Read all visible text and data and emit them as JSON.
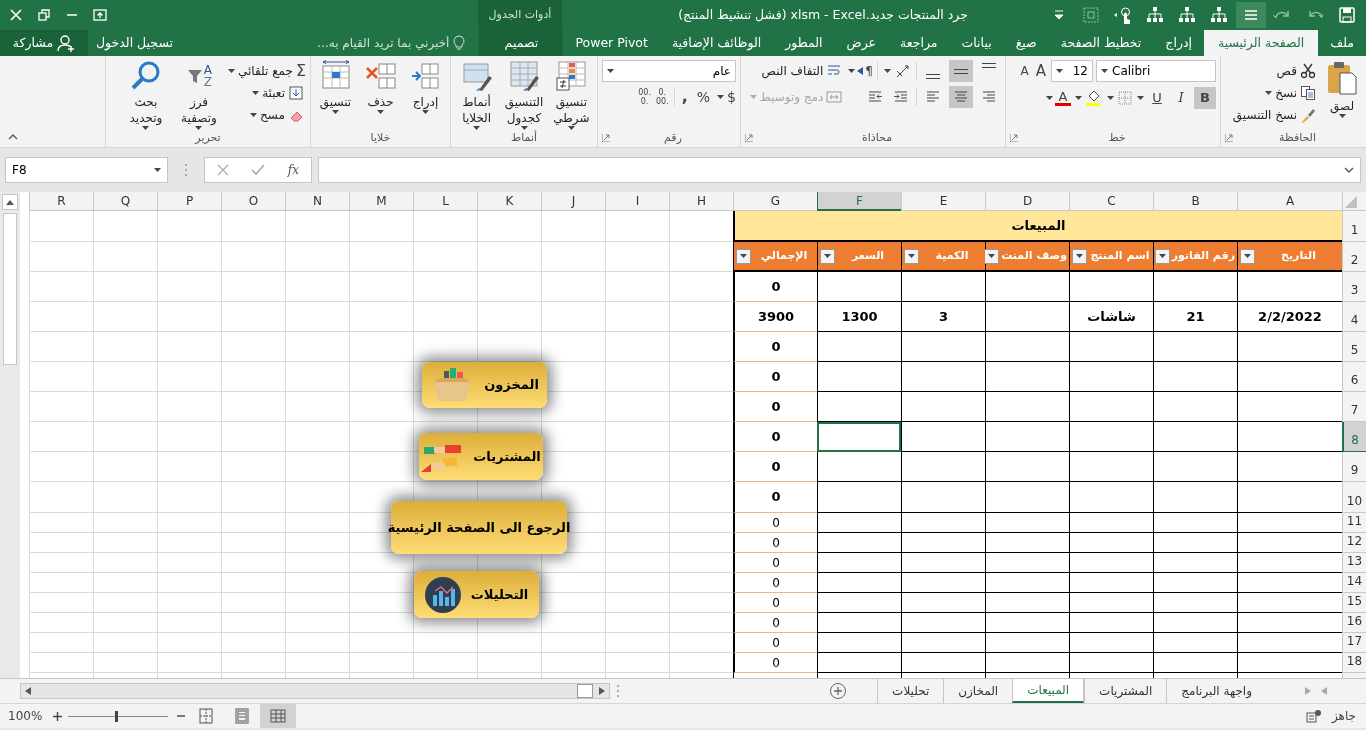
{
  "title_bar": {
    "title": "جرد المنتجات جديد.xlsm - Excel (فشل تنشيط المنتج)",
    "context_label": "أدوات الجدول"
  },
  "tabs": [
    {
      "label": "ملف",
      "selected": false,
      "kind": "tab"
    },
    {
      "label": "الصفحة الرئيسية",
      "selected": true,
      "kind": "tab"
    },
    {
      "label": "إدراج",
      "selected": false,
      "kind": "tab"
    },
    {
      "label": "تخطيط الصفحة",
      "selected": false,
      "kind": "tab"
    },
    {
      "label": "صيغ",
      "selected": false,
      "kind": "tab"
    },
    {
      "label": "بيانات",
      "selected": false,
      "kind": "tab"
    },
    {
      "label": "مراجعة",
      "selected": false,
      "kind": "tab"
    },
    {
      "label": "عرض",
      "selected": false,
      "kind": "tab"
    },
    {
      "label": "المطور",
      "selected": false,
      "kind": "tab"
    },
    {
      "label": "الوظائف الإضافية",
      "selected": false,
      "kind": "tab"
    },
    {
      "label": "Power Pivot",
      "selected": false,
      "kind": "tab"
    },
    {
      "label": "تصميم",
      "selected": false,
      "kind": "context"
    }
  ],
  "tell_me": {
    "placeholder": "أخبرني بما تريد القيام به..."
  },
  "sign_in": "تسجيل الدخول",
  "share": "مشاركة",
  "ribbon": {
    "clipboard": {
      "label": "الحافظة",
      "paste": "لصق",
      "cut": "قص",
      "copy": "نسخ",
      "format_painter": "نسخ التنسيق"
    },
    "font": {
      "label": "خط",
      "font_name": "Calibri",
      "font_size": "12",
      "grow": "A",
      "shrink": "A",
      "bold": {
        "label": "B",
        "on": true
      },
      "italic": "I",
      "underline": "U",
      "font_color": "A"
    },
    "alignment": {
      "label": "محاذاة",
      "vertical": [
        {
          "selected": false
        },
        {
          "selected": true
        },
        {
          "selected": false
        }
      ],
      "horizontal": [
        {
          "selected": false
        },
        {
          "selected": true
        },
        {
          "selected": false
        }
      ],
      "direction": "¶",
      "wrap_text": "التفاف النص",
      "merge": {
        "label": "دمج وتوسيط",
        "disabled": true
      }
    },
    "number": {
      "label": "رقم",
      "format": "عام",
      "currency": "$",
      "percent": "%",
      "comma": ",",
      "decimals": [
        ".0",
        ".00",
        ".00",
        ".0"
      ]
    },
    "styles": {
      "label": "أنماط",
      "buttons": [
        "تنسيق شرطي",
        "التنسيق كجدول",
        "أنماط الخلايا"
      ]
    },
    "cells": {
      "label": "خلايا",
      "buttons": [
        "إدراج",
        "حذف",
        "تنسيق"
      ]
    },
    "editing": {
      "label": "تحرير",
      "autosum_icon": "Σ",
      "autosum": "جمع تلقائي",
      "fill": "تعبئة",
      "clear": "مسح",
      "sort_letters": [
        "A",
        "Z"
      ],
      "sort": "فرز وتصفية",
      "find": "بحث وتحديد"
    }
  },
  "formula_bar": {
    "name_box": "F8",
    "fx": "fx"
  },
  "sheet": {
    "columns": [
      {
        "label": "A",
        "selected": false
      },
      {
        "label": "B",
        "selected": false
      },
      {
        "label": "C",
        "selected": false
      },
      {
        "label": "D",
        "selected": false
      },
      {
        "label": "E",
        "selected": false
      },
      {
        "label": "F",
        "selected": true
      },
      {
        "label": "G",
        "selected": false
      },
      {
        "label": "H",
        "selected": false
      },
      {
        "label": "I",
        "selected": false
      },
      {
        "label": "J",
        "selected": false
      },
      {
        "label": "K",
        "selected": false
      },
      {
        "label": "L",
        "selected": false
      },
      {
        "label": "M",
        "selected": false
      },
      {
        "label": "N",
        "selected": false
      },
      {
        "label": "O",
        "selected": false
      },
      {
        "label": "P",
        "selected": false
      },
      {
        "label": "Q",
        "selected": false
      },
      {
        "label": "R",
        "selected": false
      }
    ],
    "row_headers": [
      {
        "label": "1",
        "selected": false
      },
      {
        "label": "2",
        "selected": false
      },
      {
        "label": "3",
        "selected": false
      },
      {
        "label": "4",
        "selected": false
      },
      {
        "label": "5",
        "selected": false
      },
      {
        "label": "6",
        "selected": false
      },
      {
        "label": "7",
        "selected": false
      },
      {
        "label": "8",
        "selected": true
      },
      {
        "label": "9",
        "selected": false
      },
      {
        "label": "10",
        "selected": false
      },
      {
        "label": "11",
        "selected": false
      },
      {
        "label": "12",
        "selected": false
      },
      {
        "label": "13",
        "selected": false
      },
      {
        "label": "14",
        "selected": false
      },
      {
        "label": "15",
        "selected": false
      },
      {
        "label": "16",
        "selected": false
      },
      {
        "label": "17",
        "selected": false
      },
      {
        "label": "18",
        "selected": false
      }
    ],
    "table": {
      "title": "المبيعات",
      "headers": [
        "التاريخ",
        "رقم الفاتور",
        "اسم المنتج",
        "وصف المنت",
        "الكمية",
        "السعر",
        "الإجمالي"
      ],
      "rows": [
        {
          "total": "0",
          "bold": true
        },
        {
          "date": "2/2/2022",
          "invoice": "21",
          "product": "شاشات",
          "quantity": "3",
          "price": "1300",
          "total": "3900",
          "bold": true
        },
        {
          "total": "0",
          "bold": true
        },
        {
          "total": "0",
          "bold": true
        },
        {
          "total": "0",
          "bold": true
        },
        {
          "total": "0",
          "bold": true
        },
        {
          "total": "0",
          "bold": true
        },
        {
          "total": "0",
          "bold": true
        },
        {
          "total": "0",
          "bold": false
        },
        {
          "total": "0",
          "bold": false
        },
        {
          "total": "0",
          "bold": false
        },
        {
          "total": "0",
          "bold": false
        },
        {
          "total": "0",
          "bold": false
        },
        {
          "total": "0",
          "bold": false
        },
        {
          "total": "0",
          "bold": false
        },
        {
          "total": "0",
          "bold": false
        }
      ]
    },
    "buttons": [
      {
        "label": "المخزون",
        "kind": "inventory"
      },
      {
        "label": "المشتريات",
        "kind": "purchases"
      },
      {
        "label": "الرجوع الى الصفحة الرئيسية",
        "kind": "home"
      },
      {
        "label": "التحليلات",
        "kind": "analytics"
      }
    ]
  },
  "sheet_tabs": [
    {
      "label": "واجهة البرنامج",
      "selected": false
    },
    {
      "label": "المشتريات",
      "selected": false
    },
    {
      "label": "المبيعات",
      "selected": true
    },
    {
      "label": "المخازن",
      "selected": false
    },
    {
      "label": "تحليلات",
      "selected": false
    }
  ],
  "status_bar": {
    "status": "جاهز",
    "views": [
      {
        "selected": true
      },
      {
        "selected": false
      },
      {
        "selected": false
      }
    ],
    "zoom": {
      "level": 0.5
    },
    "zoom_label": "100%"
  }
}
